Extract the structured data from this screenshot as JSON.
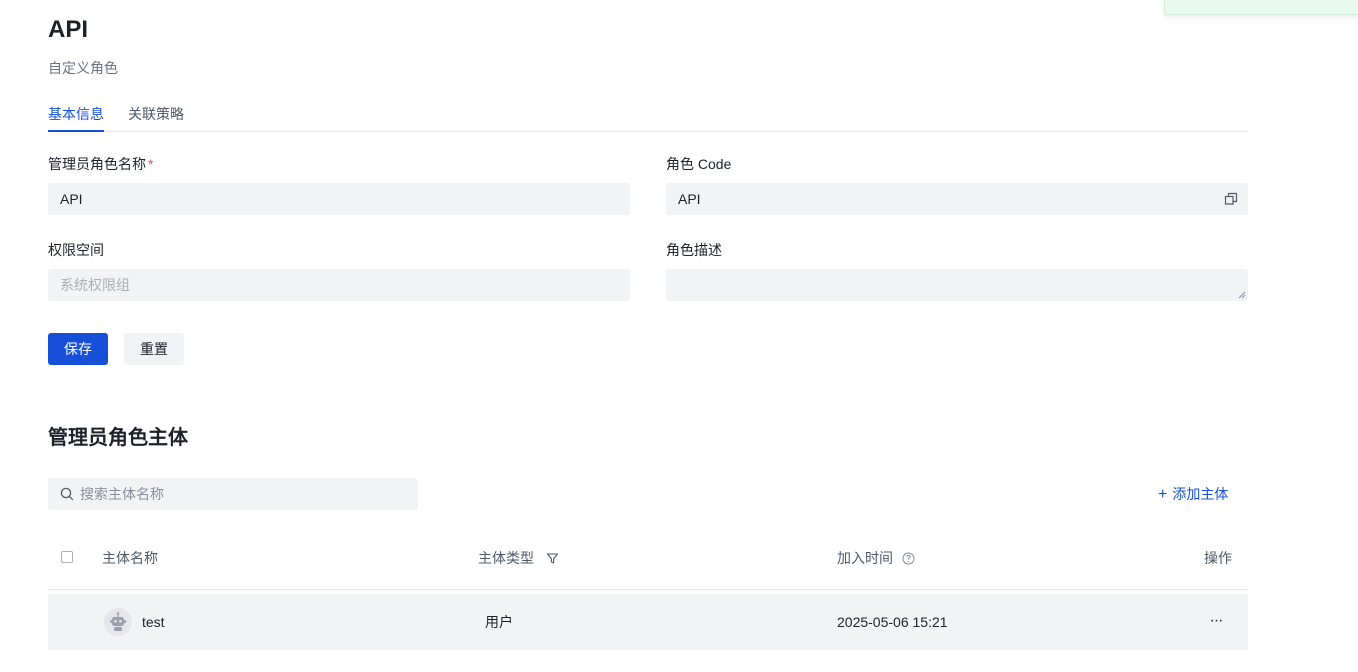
{
  "page": {
    "title": "API",
    "subtitle": "自定义角色"
  },
  "tabs": [
    {
      "label": "基本信息",
      "active": true
    },
    {
      "label": "关联策略",
      "active": false
    }
  ],
  "form": {
    "role_name": {
      "label": "管理员角色名称",
      "required_mark": "*",
      "value": "API"
    },
    "role_code": {
      "label": "角色 Code",
      "value": "API"
    },
    "permission_space": {
      "label": "权限空间",
      "placeholder": "系统权限组"
    },
    "role_description": {
      "label": "角色描述",
      "value": ""
    }
  },
  "buttons": {
    "save": "保存",
    "reset": "重置"
  },
  "subjects": {
    "title": "管理员角色主体",
    "search_placeholder": "搜索主体名称",
    "add_label": "添加主体",
    "add_icon": "+",
    "columns": [
      "主体名称",
      "主体类型",
      "加入时间",
      "操作"
    ],
    "rows": [
      {
        "name": "test",
        "type": "用户",
        "joined_at": "2025-05-06 15:21",
        "action": "···"
      }
    ]
  },
  "colors": {
    "accent": "#1650d8",
    "toast_bg": "#e8fbee",
    "input_bg": "#f2f3f5",
    "required": "#e34d59"
  },
  "icons": {
    "copy": "copy-icon",
    "search": "search-icon",
    "filter": "filter-icon",
    "help": "help-circle-icon",
    "avatar": "robot-avatar-icon",
    "more": "more-icon"
  }
}
